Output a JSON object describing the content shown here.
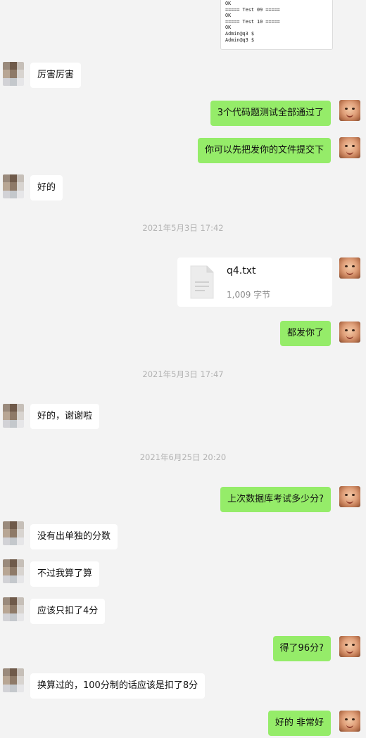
{
  "code_snippet": {
    "lines": [
      "OK",
      "",
      "===== Test 09 =====",
      "OK",
      "",
      "===== Test 10 =====",
      "OK",
      "Admin@q3 $",
      "Admin@q3 $"
    ]
  },
  "messages": [
    {
      "side": "in",
      "text": "厉害厉害"
    },
    {
      "side": "out",
      "text": "3个代码题测试全部通过了"
    },
    {
      "side": "out",
      "text": "你可以先把发你的文件提交下"
    },
    {
      "side": "in",
      "text": "好的"
    },
    {
      "side": "out",
      "text": "都发你了"
    },
    {
      "side": "in",
      "text": "好的，谢谢啦"
    },
    {
      "side": "out",
      "text": "上次数据库考试多少分?"
    },
    {
      "side": "in",
      "text": "没有出单独的分数"
    },
    {
      "side": "in",
      "text": "不过我算了算"
    },
    {
      "side": "in",
      "text": "应该只扣了4分"
    },
    {
      "side": "out",
      "text": "得了96分?"
    },
    {
      "side": "in",
      "text": "换算过的，100分制的话应该是扣了8分"
    },
    {
      "side": "out",
      "text": "好的 非常好"
    }
  ],
  "timestamps": [
    "2021年5月3日 17:42",
    "2021年5月3日 17:47",
    "2021年6月25日 20:20"
  ],
  "file": {
    "name": "q4.txt",
    "size": "1,009 字节",
    "icon": "document-icon"
  },
  "colors": {
    "background": "#f3f3f3",
    "incoming_bubble": "#ffffff",
    "outgoing_bubble": "#95ec69",
    "timestamp_text": "#b2b2b2"
  }
}
